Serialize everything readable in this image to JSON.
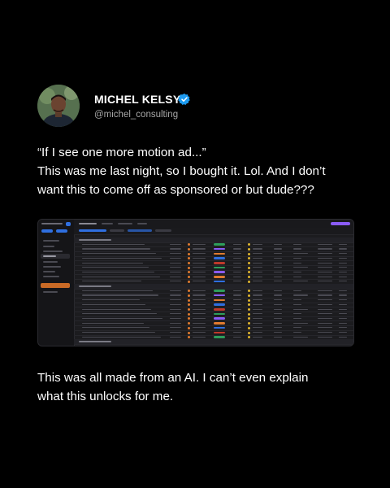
{
  "author": {
    "name": "MICHEL KELSY",
    "handle": "@michel_consulting",
    "verified_color": "#1d9bf0"
  },
  "tweet": {
    "lines": [
      "“If I see one more motion ad...”",
      "This was me last night, so I bought it. Lol. And I don’t",
      "want this to come off as sponsored or but dude???"
    ]
  },
  "caption": {
    "lines": [
      "This was all made from an AI. I can’t even explain",
      "what this unlocks for me."
    ]
  },
  "colors": {
    "background": "#000000",
    "text": "#ffffff",
    "muted": "#a7a7a7",
    "accent_blue": "#2f6fe0",
    "accent_purple": "#8b5cf6",
    "accent_orange": "#e07b2f",
    "status_red": "#c0392b",
    "status_green": "#2e9e5b"
  },
  "icons": {
    "verified": "verified-badge-icon",
    "avatar": "profile-photo"
  }
}
